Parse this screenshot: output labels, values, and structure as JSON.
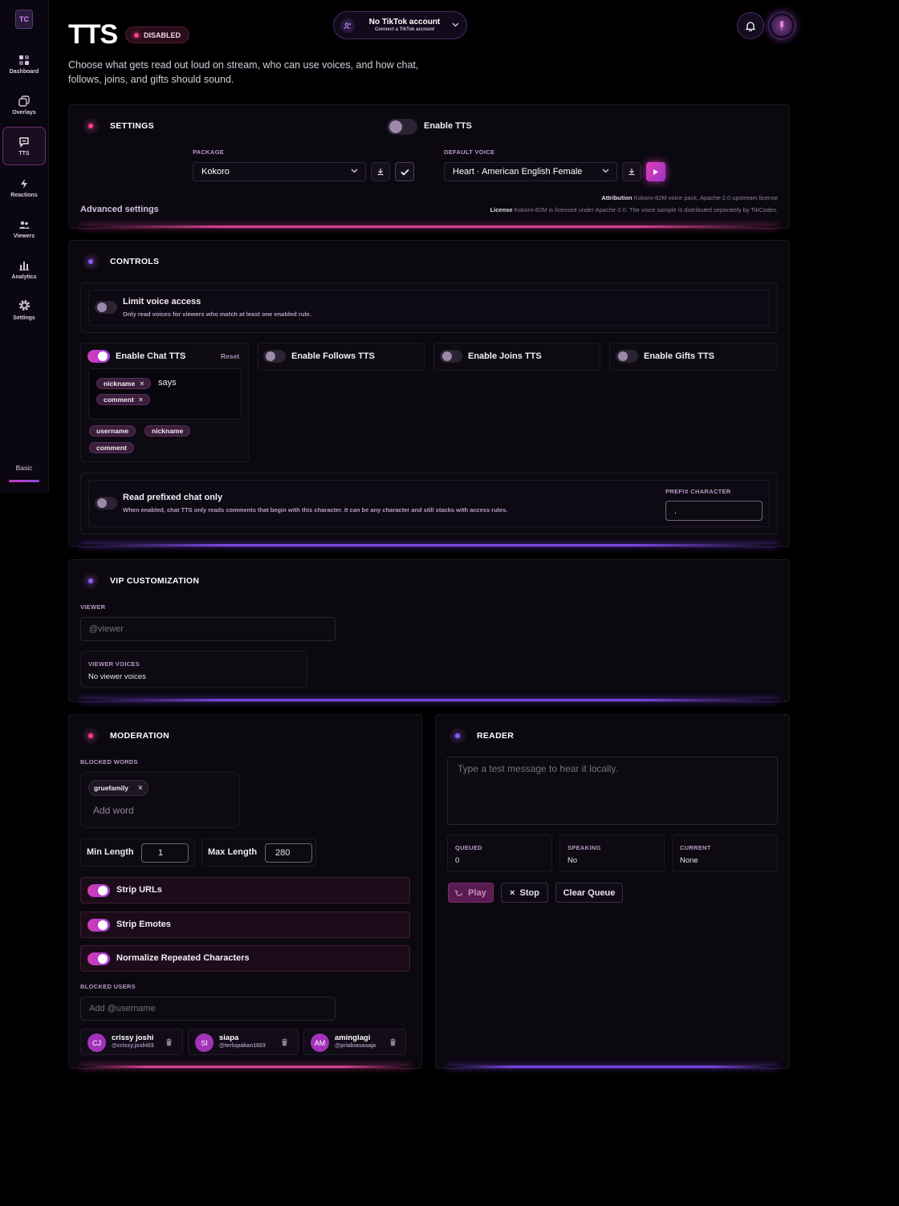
{
  "nav": {
    "logo": "TC",
    "items": [
      {
        "label": "Dashboard",
        "icon": "dashboard-icon"
      },
      {
        "label": "Overlays",
        "icon": "overlays-icon"
      },
      {
        "label": "TTS",
        "icon": "chat-bubble-icon"
      },
      {
        "label": "Reactions",
        "icon": "lightning-icon"
      },
      {
        "label": "Viewers",
        "icon": "people-icon"
      },
      {
        "label": "Analytics",
        "icon": "bar-chart-icon"
      },
      {
        "label": "Settings",
        "icon": "gear-icon"
      }
    ],
    "active": "TTS",
    "plan": "Basic"
  },
  "header": {
    "title": "TTS",
    "status_badge": "DISABLED",
    "subtitle": "Choose what gets read out loud on stream, who can use voices, and how chat, follows, joins, and gifts should sound.",
    "account_title": "No TikTok account",
    "account_subtitle": "Connect a TikTok account"
  },
  "settings": {
    "title": "SETTINGS",
    "enable_tts_label": "Enable TTS",
    "enable_tts": false,
    "package_label": "PACKAGE",
    "package_value": "Kokoro",
    "default_voice_label": "DEFAULT VOICE",
    "default_voice_value": "Heart · American English Female",
    "advanced_label": "Advanced settings",
    "attribution_key": "Attribution",
    "attribution_value": "Kokoro-82M voice pack, Apache-2.0 upstream license",
    "license_key": "License",
    "license_value": "Kokoro-82M is licensed under Apache-2.0. The voice sample is distributed separately by TikCodex."
  },
  "controls": {
    "title": "CONTROLS",
    "limit_title": "Limit voice access",
    "limit_desc": "Only read voices for viewers who match at least one enabled rule.",
    "chat_label": "Enable Chat TTS",
    "chat_reset": "Reset",
    "template_chips": [
      "nickname",
      "comment"
    ],
    "template_text": "says",
    "variable_chips": [
      "username",
      "nickname",
      "comment"
    ],
    "follows_label": "Enable Follows TTS",
    "joins_label": "Enable Joins TTS",
    "gifts_label": "Enable Gifts TTS",
    "prefix_title": "Read prefixed chat only",
    "prefix_desc": "When enabled, chat TTS only reads comments that begin with this character. It can be any character and still stacks with access rules.",
    "prefix_char_label": "PREFIX CHARACTER",
    "prefix_char_value": "."
  },
  "vip": {
    "title": "VIP CUSTOMIZATION",
    "viewer_label": "VIEWER",
    "viewer_placeholder": "@viewer",
    "voices_label": "VIEWER VOICES",
    "voices_value": "No viewer voices"
  },
  "moderation": {
    "title": "MODERATION",
    "blocked_words_label": "BLOCKED WORDS",
    "blocked_word": "gruefamily",
    "add_word_placeholder": "Add word",
    "min_label": "Min Length",
    "min_value": "1",
    "max_label": "Max Length",
    "max_value": "280",
    "strip_urls": "Strip URLs",
    "strip_emotes": "Strip Emotes",
    "normalize": "Normalize Repeated Characters",
    "blocked_users_label": "BLOCKED USERS",
    "add_user_placeholder": "Add @username",
    "users": [
      {
        "initials": "CJ",
        "name": "crissy joshi",
        "handle": "@crissy.joshi03"
      },
      {
        "initials": "SI",
        "name": "siapa",
        "handle": "@terlupakan1603"
      },
      {
        "initials": "AM",
        "name": "aminglagi",
        "handle": "@priabiasasaja"
      }
    ]
  },
  "reader": {
    "title": "READER",
    "placeholder": "Type a test message to hear it locally.",
    "queued_label": "QUEUED",
    "queued_value": "0",
    "speaking_label": "SPEAKING",
    "speaking_value": "No",
    "current_label": "CURRENT",
    "current_value": "None",
    "play": "Play",
    "stop": "Stop",
    "clear": "Clear Queue"
  },
  "colors": {
    "accent_pink": "#d53bb4",
    "accent_purple": "#8f49ea",
    "status_red": "#ff3d7c"
  }
}
